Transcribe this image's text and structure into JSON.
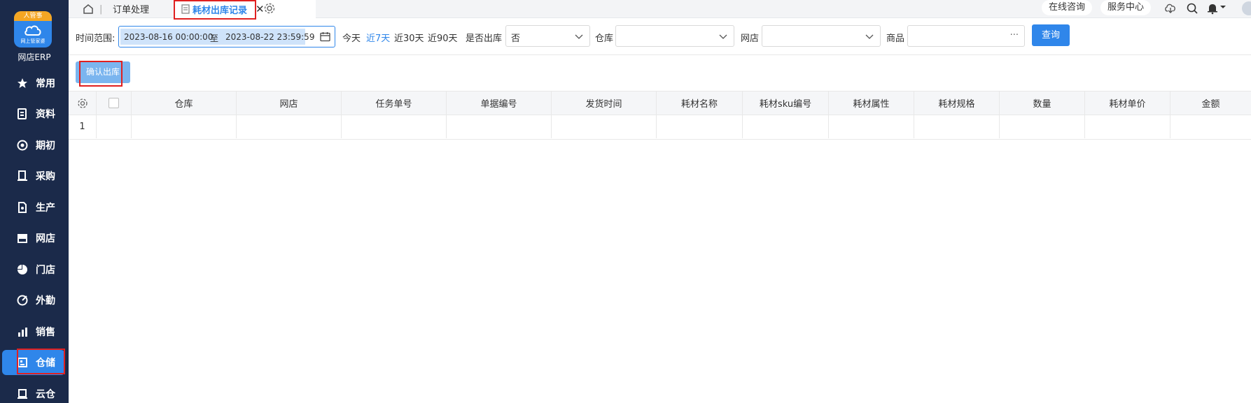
{
  "sidebar": {
    "logo_top": "人管事",
    "logo_sub": "网上管家婆",
    "app_name": "网店ERP",
    "items": [
      {
        "label": "常用",
        "icon": "star-icon"
      },
      {
        "label": "资料",
        "icon": "document-icon"
      },
      {
        "label": "期初",
        "icon": "target-icon"
      },
      {
        "label": "采购",
        "icon": "purchase-icon"
      },
      {
        "label": "生产",
        "icon": "production-icon"
      },
      {
        "label": "网店",
        "icon": "shop-icon"
      },
      {
        "label": "门店",
        "icon": "pie-icon"
      },
      {
        "label": "外勤",
        "icon": "field-icon"
      },
      {
        "label": "销售",
        "icon": "sales-icon"
      },
      {
        "label": "仓储",
        "icon": "warehouse-icon",
        "active": true
      },
      {
        "label": "云仓",
        "icon": "cloud-warehouse-icon"
      }
    ]
  },
  "tabs": {
    "sep": "|",
    "items": [
      {
        "label": "订单处理"
      },
      {
        "label": "耗材出库记录",
        "active": true
      }
    ],
    "close": "✕"
  },
  "topbar": {
    "online_consult": "在线咨询",
    "service_center": "服务中心"
  },
  "filters": {
    "time_range_label": "时间范围:",
    "date_start": "2023-08-16 00:00:00",
    "date_to": "至",
    "date_end": "2023-08-22 23:59:59",
    "quick": [
      "今天",
      "近7天",
      "近30天",
      "近90天"
    ],
    "quick_active": "近7天",
    "out_label": "是否出库",
    "out_value": "否",
    "warehouse_label": "仓库",
    "warehouse_value": "",
    "shop_label": "网店",
    "shop_value": "",
    "product_label": "商品",
    "product_value": "",
    "more": "···",
    "query_button": "查询"
  },
  "actions": {
    "confirm_out": "确认出库"
  },
  "table": {
    "columns": [
      "仓库",
      "网店",
      "任务单号",
      "单据编号",
      "发货时间",
      "耗材名称",
      "耗材sku编号",
      "耗材属性",
      "耗材规格",
      "数量",
      "耗材单价",
      "金额"
    ],
    "rows": [
      {
        "index": "1",
        "cells": [
          "",
          "",
          "",
          "",
          "",
          "",
          "",
          "",
          "",
          "",
          "",
          ""
        ]
      }
    ]
  },
  "colors": {
    "sidebar_bg": "#1b2a4a",
    "accent": "#2f86ea",
    "highlight_box": "#e02020",
    "confirm_button": "#7bb5ef"
  }
}
